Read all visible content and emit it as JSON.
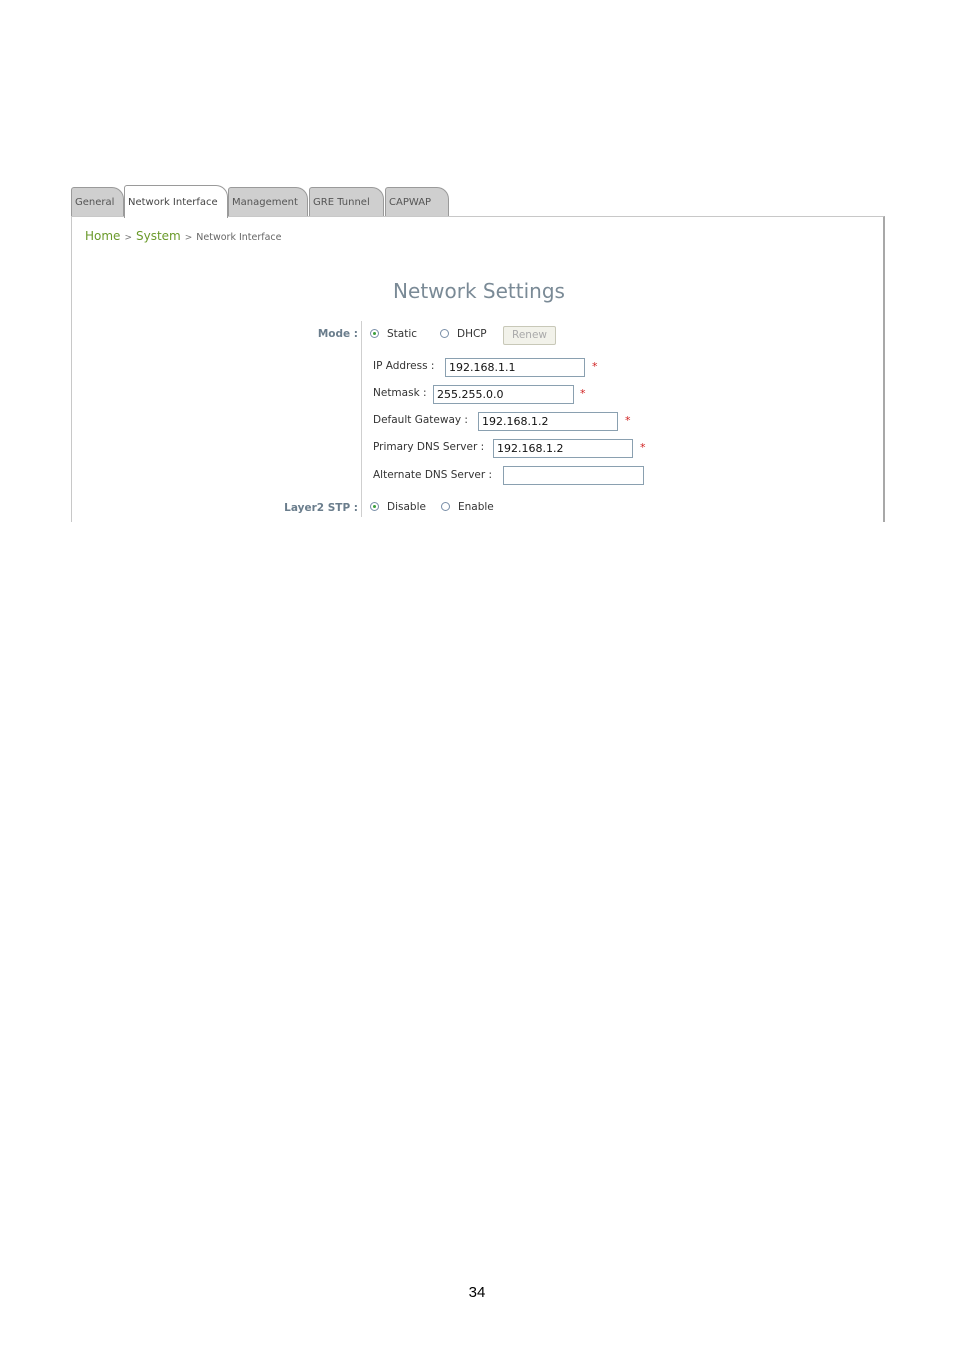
{
  "tabs": [
    {
      "label": "General",
      "active": false
    },
    {
      "label": "Network Interface",
      "active": true
    },
    {
      "label": "Management",
      "active": false
    },
    {
      "label": "GRE Tunnel",
      "active": false
    },
    {
      "label": "CAPWAP",
      "active": false
    }
  ],
  "breadcrumb": {
    "home": "Home",
    "sep1": ">",
    "system": "System",
    "sep2": ">",
    "current": "Network Interface"
  },
  "title": "Network Settings",
  "mode": {
    "label": "Mode :",
    "options": [
      {
        "label": "Static",
        "selected": true
      },
      {
        "label": "DHCP",
        "selected": false
      }
    ],
    "renew_label": "Renew"
  },
  "fields": [
    {
      "label": "IP Address :",
      "value": "192.168.1.1",
      "required": "*"
    },
    {
      "label": "Netmask :",
      "value": "255.255.0.0",
      "required": "*"
    },
    {
      "label": "Default Gateway :",
      "value": "192.168.1.2",
      "required": "*"
    },
    {
      "label": "Primary DNS Server :",
      "value": "192.168.1.2",
      "required": "*"
    },
    {
      "label": "Alternate DNS Server :",
      "value": "",
      "required": ""
    }
  ],
  "stp": {
    "label": "Layer2 STP :",
    "options": [
      {
        "label": "Disable",
        "selected": true
      },
      {
        "label": "Enable",
        "selected": false
      }
    ]
  },
  "page_number": "34"
}
